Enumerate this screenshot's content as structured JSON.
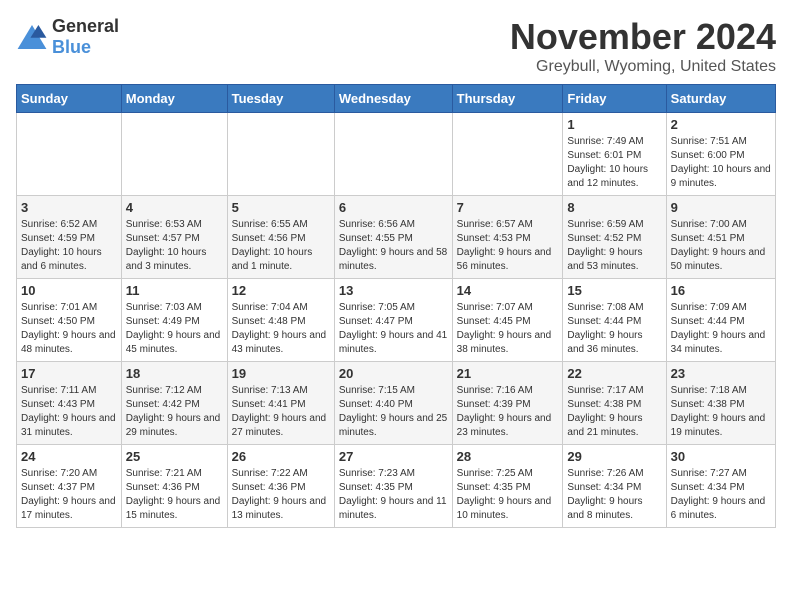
{
  "logo": {
    "general": "General",
    "blue": "Blue"
  },
  "title": "November 2024",
  "location": "Greybull, Wyoming, United States",
  "days_of_week": [
    "Sunday",
    "Monday",
    "Tuesday",
    "Wednesday",
    "Thursday",
    "Friday",
    "Saturday"
  ],
  "weeks": [
    [
      {
        "day": "",
        "info": ""
      },
      {
        "day": "",
        "info": ""
      },
      {
        "day": "",
        "info": ""
      },
      {
        "day": "",
        "info": ""
      },
      {
        "day": "",
        "info": ""
      },
      {
        "day": "1",
        "info": "Sunrise: 7:49 AM\nSunset: 6:01 PM\nDaylight: 10 hours and 12 minutes."
      },
      {
        "day": "2",
        "info": "Sunrise: 7:51 AM\nSunset: 6:00 PM\nDaylight: 10 hours and 9 minutes."
      }
    ],
    [
      {
        "day": "3",
        "info": "Sunrise: 6:52 AM\nSunset: 4:59 PM\nDaylight: 10 hours and 6 minutes."
      },
      {
        "day": "4",
        "info": "Sunrise: 6:53 AM\nSunset: 4:57 PM\nDaylight: 10 hours and 3 minutes."
      },
      {
        "day": "5",
        "info": "Sunrise: 6:55 AM\nSunset: 4:56 PM\nDaylight: 10 hours and 1 minute."
      },
      {
        "day": "6",
        "info": "Sunrise: 6:56 AM\nSunset: 4:55 PM\nDaylight: 9 hours and 58 minutes."
      },
      {
        "day": "7",
        "info": "Sunrise: 6:57 AM\nSunset: 4:53 PM\nDaylight: 9 hours and 56 minutes."
      },
      {
        "day": "8",
        "info": "Sunrise: 6:59 AM\nSunset: 4:52 PM\nDaylight: 9 hours and 53 minutes."
      },
      {
        "day": "9",
        "info": "Sunrise: 7:00 AM\nSunset: 4:51 PM\nDaylight: 9 hours and 50 minutes."
      }
    ],
    [
      {
        "day": "10",
        "info": "Sunrise: 7:01 AM\nSunset: 4:50 PM\nDaylight: 9 hours and 48 minutes."
      },
      {
        "day": "11",
        "info": "Sunrise: 7:03 AM\nSunset: 4:49 PM\nDaylight: 9 hours and 45 minutes."
      },
      {
        "day": "12",
        "info": "Sunrise: 7:04 AM\nSunset: 4:48 PM\nDaylight: 9 hours and 43 minutes."
      },
      {
        "day": "13",
        "info": "Sunrise: 7:05 AM\nSunset: 4:47 PM\nDaylight: 9 hours and 41 minutes."
      },
      {
        "day": "14",
        "info": "Sunrise: 7:07 AM\nSunset: 4:45 PM\nDaylight: 9 hours and 38 minutes."
      },
      {
        "day": "15",
        "info": "Sunrise: 7:08 AM\nSunset: 4:44 PM\nDaylight: 9 hours and 36 minutes."
      },
      {
        "day": "16",
        "info": "Sunrise: 7:09 AM\nSunset: 4:44 PM\nDaylight: 9 hours and 34 minutes."
      }
    ],
    [
      {
        "day": "17",
        "info": "Sunrise: 7:11 AM\nSunset: 4:43 PM\nDaylight: 9 hours and 31 minutes."
      },
      {
        "day": "18",
        "info": "Sunrise: 7:12 AM\nSunset: 4:42 PM\nDaylight: 9 hours and 29 minutes."
      },
      {
        "day": "19",
        "info": "Sunrise: 7:13 AM\nSunset: 4:41 PM\nDaylight: 9 hours and 27 minutes."
      },
      {
        "day": "20",
        "info": "Sunrise: 7:15 AM\nSunset: 4:40 PM\nDaylight: 9 hours and 25 minutes."
      },
      {
        "day": "21",
        "info": "Sunrise: 7:16 AM\nSunset: 4:39 PM\nDaylight: 9 hours and 23 minutes."
      },
      {
        "day": "22",
        "info": "Sunrise: 7:17 AM\nSunset: 4:38 PM\nDaylight: 9 hours and 21 minutes."
      },
      {
        "day": "23",
        "info": "Sunrise: 7:18 AM\nSunset: 4:38 PM\nDaylight: 9 hours and 19 minutes."
      }
    ],
    [
      {
        "day": "24",
        "info": "Sunrise: 7:20 AM\nSunset: 4:37 PM\nDaylight: 9 hours and 17 minutes."
      },
      {
        "day": "25",
        "info": "Sunrise: 7:21 AM\nSunset: 4:36 PM\nDaylight: 9 hours and 15 minutes."
      },
      {
        "day": "26",
        "info": "Sunrise: 7:22 AM\nSunset: 4:36 PM\nDaylight: 9 hours and 13 minutes."
      },
      {
        "day": "27",
        "info": "Sunrise: 7:23 AM\nSunset: 4:35 PM\nDaylight: 9 hours and 11 minutes."
      },
      {
        "day": "28",
        "info": "Sunrise: 7:25 AM\nSunset: 4:35 PM\nDaylight: 9 hours and 10 minutes."
      },
      {
        "day": "29",
        "info": "Sunrise: 7:26 AM\nSunset: 4:34 PM\nDaylight: 9 hours and 8 minutes."
      },
      {
        "day": "30",
        "info": "Sunrise: 7:27 AM\nSunset: 4:34 PM\nDaylight: 9 hours and 6 minutes."
      }
    ]
  ]
}
